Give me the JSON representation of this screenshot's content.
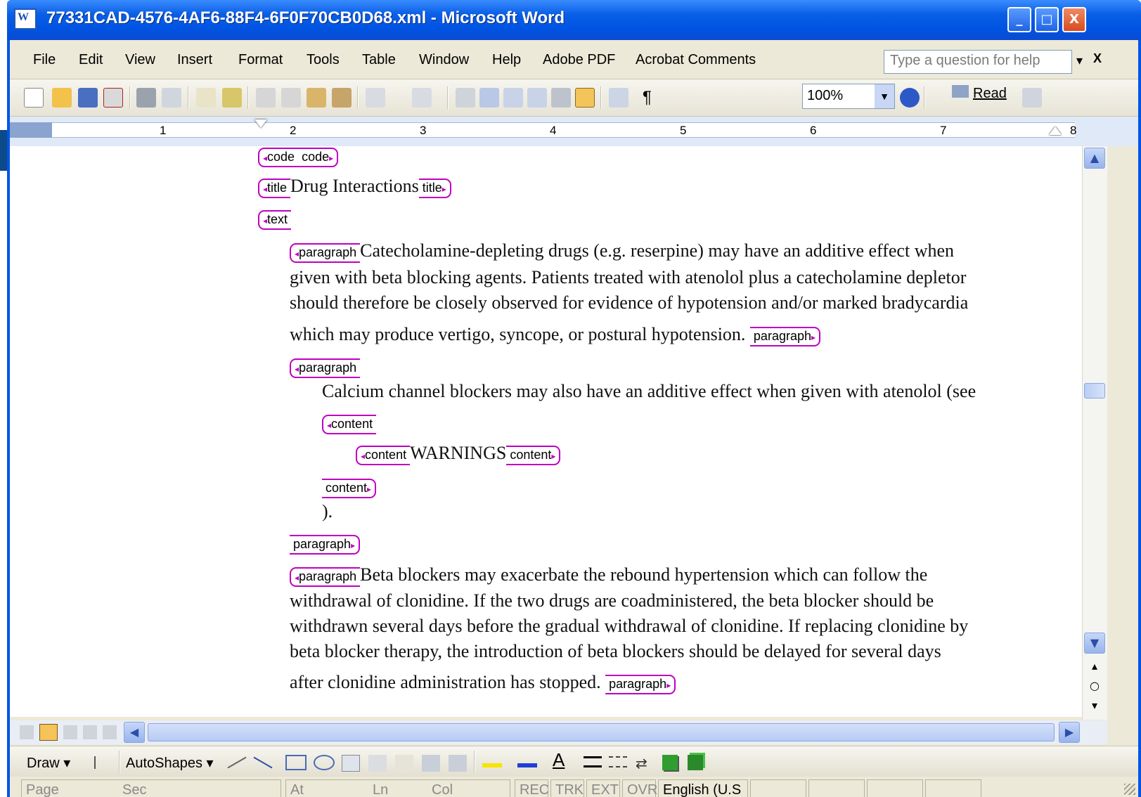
{
  "window": {
    "title": "77331CAD-4576-4AF6-88F4-6F0F70CB0D68.xml - Microsoft Word",
    "min": "_",
    "max": "□",
    "close": "X"
  },
  "menu": [
    "File",
    "Edit",
    "View",
    "Insert",
    "Format",
    "Tools",
    "Table",
    "Window",
    "Help",
    "Adobe PDF",
    "Acrobat Comments"
  ],
  "help_box": {
    "placeholder": "Type a question for help",
    "arrow": "▾",
    "close": "X"
  },
  "toolbar": {
    "zoom": "100%",
    "read": "Read",
    "pilcrow": "¶"
  },
  "ruler": {
    "marks": [
      "1",
      "2",
      "3",
      "4",
      "5",
      "6",
      "7",
      "8"
    ]
  },
  "doc": {
    "code_open": "code",
    "code_close": "code",
    "title_open": "title",
    "title_text": "Drug Interactions",
    "title_close": "title",
    "text_open": "text",
    "p1_open": "paragraph",
    "p1_lines": [
      "Catecholamine-depleting drugs (e.g. reserpine) may have an additive effect when",
      "given with beta blocking agents. Patients treated with atenolol plus a catecholamine depletor",
      "should therefore be closely observed for evidence of hypotension and/or marked bradycardia",
      "which may produce vertigo, syncope, or postural hypotension."
    ],
    "p1_close": "paragraph",
    "p2_open": "paragraph",
    "p2_line": "Calcium channel blockers may also have an additive effect when given with atenolol (see",
    "content_open": "content",
    "inner_content_open": "content",
    "warnings": "WARNINGS",
    "inner_content_close": "content",
    "content_close": "content",
    "p2_tail": ").",
    "p2_close": "paragraph",
    "p3_open": "paragraph",
    "p3_lines": [
      "Beta blockers may exacerbate the rebound hypertension which can follow the",
      "withdrawal of clonidine. If the two drugs are coadministered, the beta blocker should be",
      "withdrawn several days before the gradual withdrawal of clonidine. If replacing clonidine by",
      "beta blocker therapy, the introduction of beta blockers should be delayed for several days",
      "after clonidine administration has stopped."
    ],
    "p3_close": "paragraph"
  },
  "drawbar": {
    "draw": "Draw",
    "autoshapes": "AutoShapes"
  },
  "status": {
    "page": "Page",
    "sec": "Sec",
    "at": "At",
    "ln": "Ln",
    "col": "Col",
    "rec": "REC",
    "trk": "TRK",
    "ext": "EXT",
    "ovr": "OVR",
    "lang": "English (U.S"
  }
}
